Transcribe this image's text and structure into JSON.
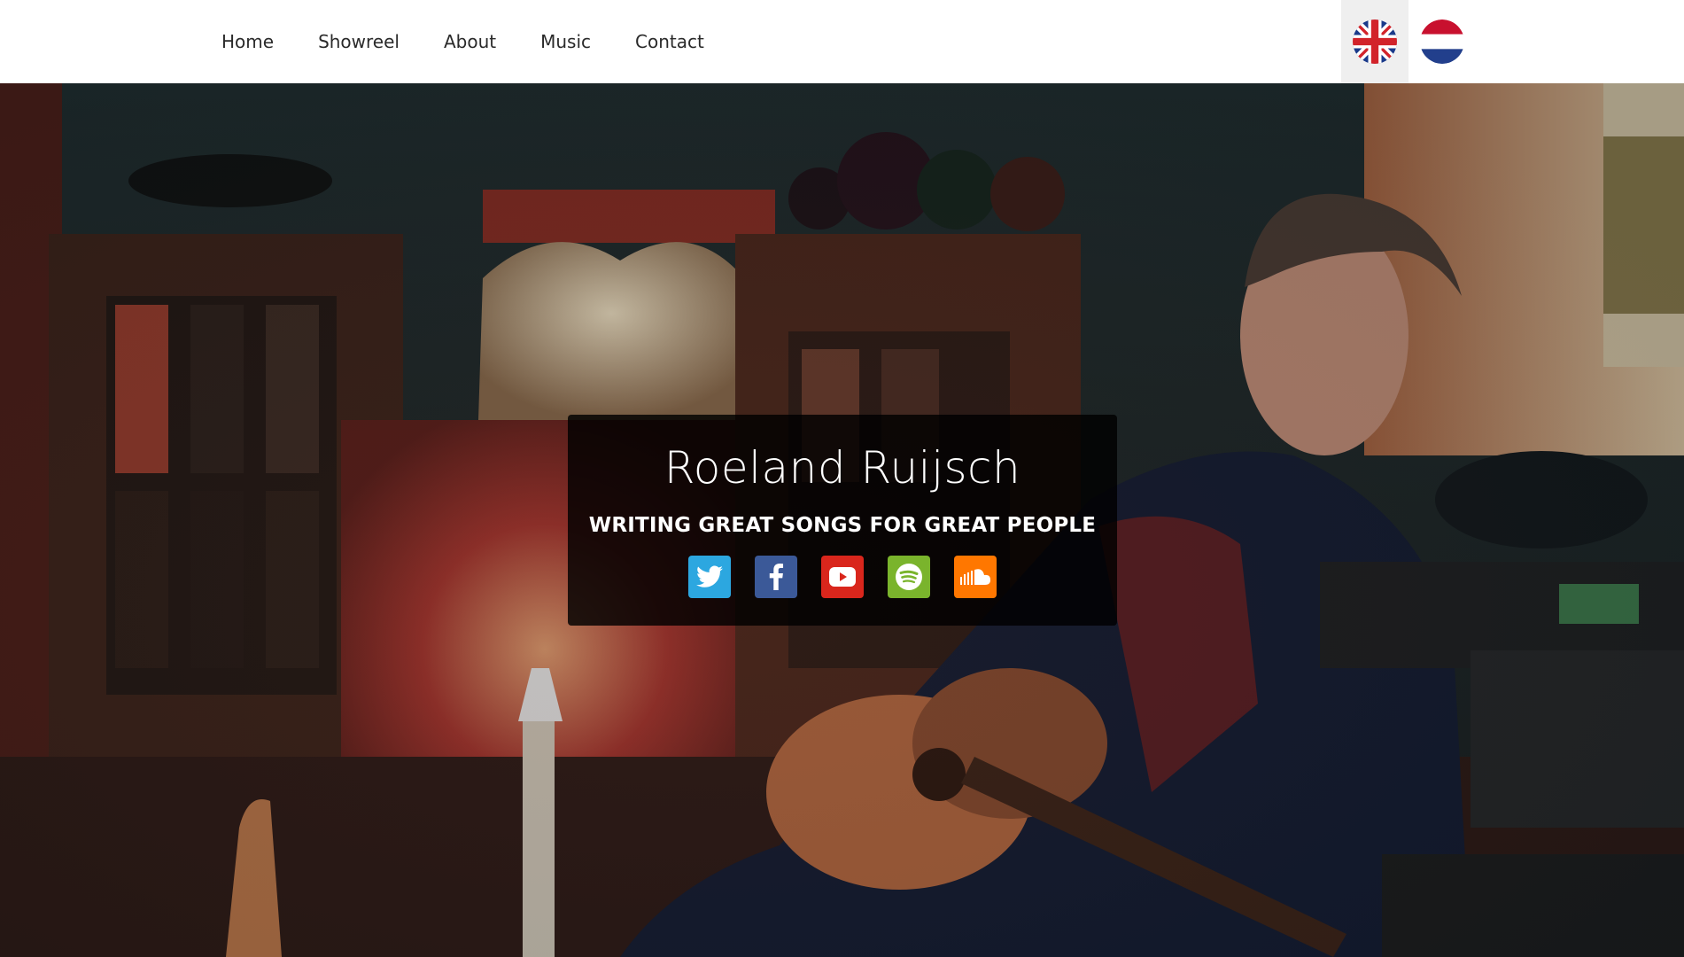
{
  "nav": {
    "items": [
      {
        "label": "Home"
      },
      {
        "label": "Showreel"
      },
      {
        "label": "About"
      },
      {
        "label": "Music"
      },
      {
        "label": "Contact"
      }
    ]
  },
  "languages": [
    {
      "icon": "uk-flag-icon",
      "active": true
    },
    {
      "icon": "netherlands-flag-icon",
      "active": false
    }
  ],
  "hero": {
    "title": "Roeland Ruijsch",
    "tagline": "WRITING GREAT SONGS FOR GREAT PEOPLE",
    "socials": [
      {
        "icon": "twitter-icon",
        "color": "#2ca7e0"
      },
      {
        "icon": "facebook-icon",
        "color": "#3b5998"
      },
      {
        "icon": "youtube-icon",
        "color": "#d9261c"
      },
      {
        "icon": "spotify-icon",
        "color": "#7ab42c"
      },
      {
        "icon": "soundcloud-icon",
        "color": "#ff7700"
      }
    ]
  }
}
